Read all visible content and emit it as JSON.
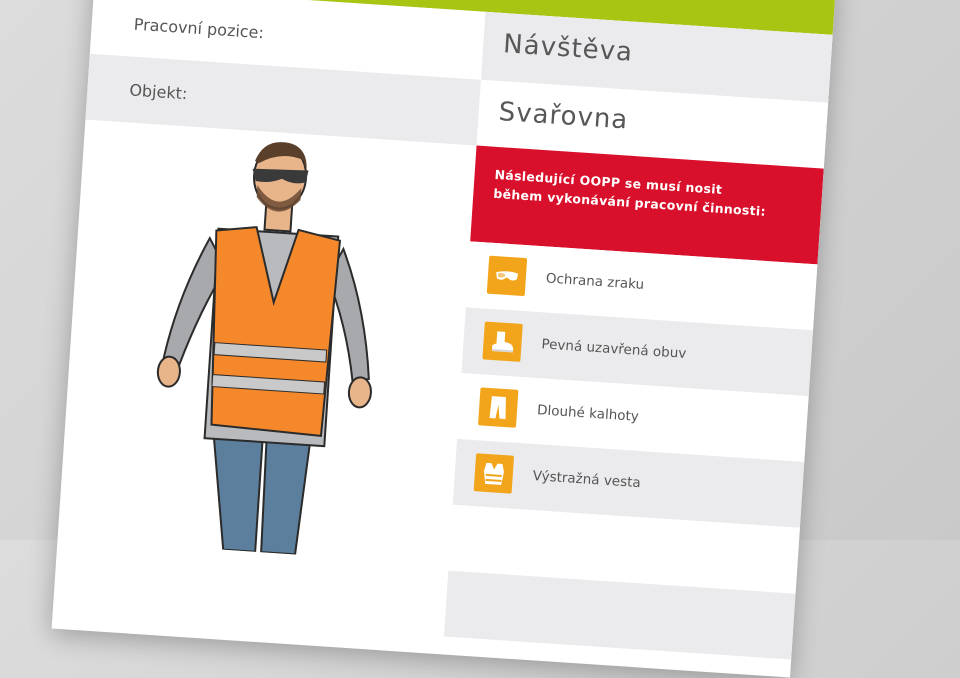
{
  "form": {
    "position_label": "Pracovní pozice:",
    "object_label": "Objekt:",
    "position_value": "Návštěva",
    "object_value": "Svařovna"
  },
  "notice": {
    "line1": "Následující OOPP se musí nosit",
    "line2": "během vykonávání pracovní činnosti:"
  },
  "ppe_items": [
    {
      "label": "Ochrana zraku",
      "icon": "safety-glasses-icon"
    },
    {
      "label": "Pevná uzavřená obuv",
      "icon": "safety-boot-icon"
    },
    {
      "label": "Dlouhé kalhoty",
      "icon": "trousers-icon"
    },
    {
      "label": "Výstražná vesta",
      "icon": "hi-vis-vest-icon"
    }
  ],
  "colors": {
    "accent_green": "#a9c513",
    "notice_red": "#d9102b",
    "icon_orange": "#f2a51a",
    "row_grey": "#ebebed"
  }
}
